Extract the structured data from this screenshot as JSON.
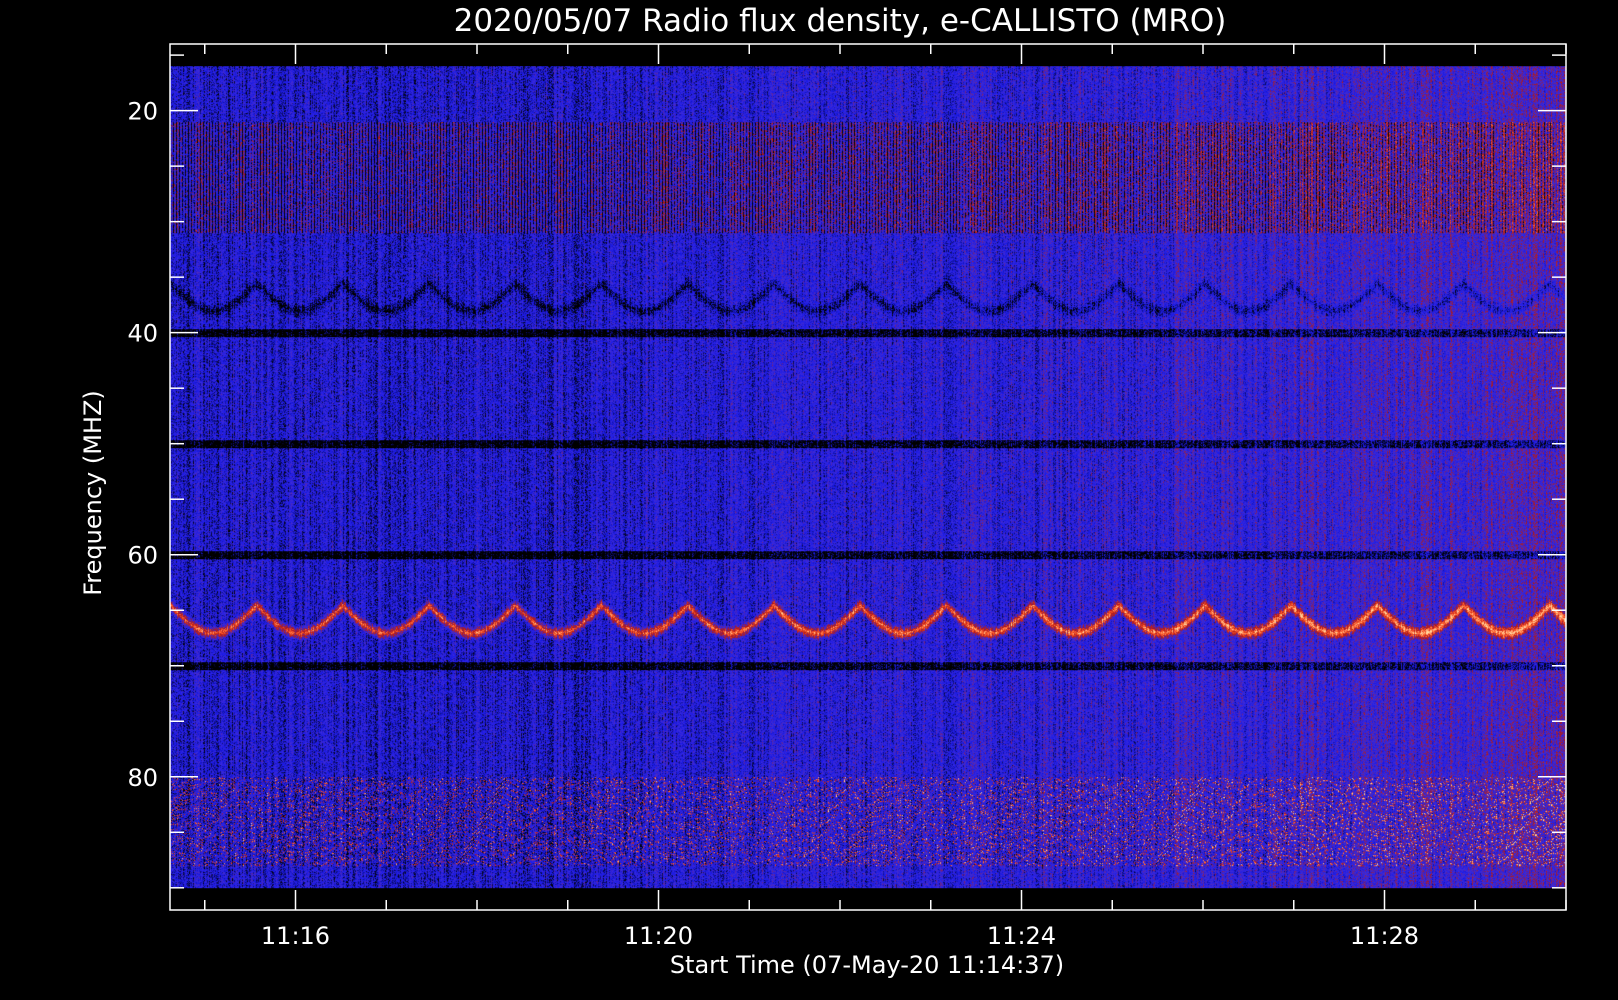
{
  "chart_data": {
    "type": "heatmap",
    "title": "2020/05/07  Radio flux density, e-CALLISTO (MRO)",
    "xlabel": "Start Time (07-May-20 11:14:37)",
    "ylabel": "Frequency (MHZ)",
    "x_tick_labels": [
      "11:16",
      "11:20",
      "11:24",
      "11:28"
    ],
    "x_tick_values_min": [
      16,
      20,
      24,
      28
    ],
    "x_range_min": [
      14.617,
      30.0
    ],
    "y_tick_labels": [
      "20",
      "40",
      "60",
      "80"
    ],
    "y_tick_values_mhz": [
      20,
      40,
      60,
      80
    ],
    "y_range_mhz": [
      14,
      92
    ],
    "y_reversed": true,
    "data_extent": {
      "time_start": "11:14:37",
      "time_end": "11:30:00",
      "freq_min_mhz": 16,
      "freq_max_mhz": 90
    },
    "colormap": [
      "#000000",
      "#1a1ae6",
      "#3d2bd8",
      "#b01818",
      "#ff5a2a",
      "#ffd8a0"
    ],
    "features": [
      {
        "name": "broadband interference band",
        "freq_mhz": [
          21,
          31
        ]
      },
      {
        "name": "periodic arcs",
        "freq_mhz": [
          33,
          38
        ]
      },
      {
        "name": "periodic arcs",
        "freq_mhz": [
          62,
          67
        ]
      },
      {
        "name": "horizontal line",
        "freq_mhz": 40
      },
      {
        "name": "horizontal line",
        "freq_mhz": 50
      },
      {
        "name": "horizontal line",
        "freq_mhz": 60
      },
      {
        "name": "horizontal line",
        "freq_mhz": 70
      },
      {
        "name": "noisy band",
        "freq_mhz": [
          80,
          88
        ]
      }
    ]
  }
}
